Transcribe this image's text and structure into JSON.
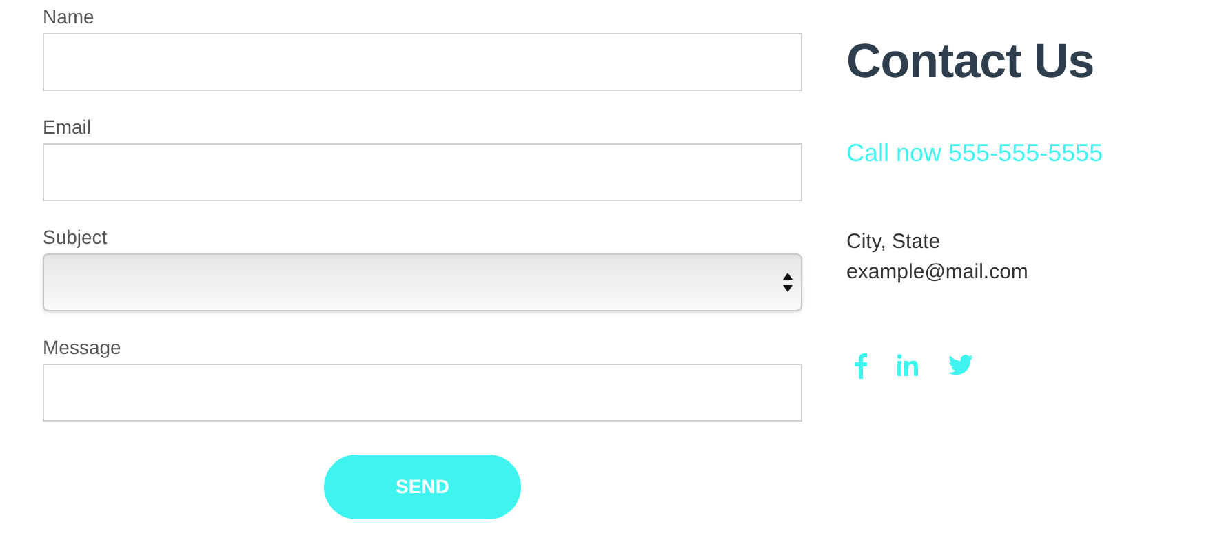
{
  "form": {
    "fields": [
      {
        "label": "Name",
        "kind": "text"
      },
      {
        "label": "Email",
        "kind": "text"
      },
      {
        "label": "Subject",
        "kind": "select"
      },
      {
        "label": "Message",
        "kind": "text"
      }
    ],
    "submit": "SEND"
  },
  "contact": {
    "title": "Contact Us",
    "phone": "Call now 555-555-5555",
    "address": "City, State",
    "email": "example@mail.com"
  }
}
